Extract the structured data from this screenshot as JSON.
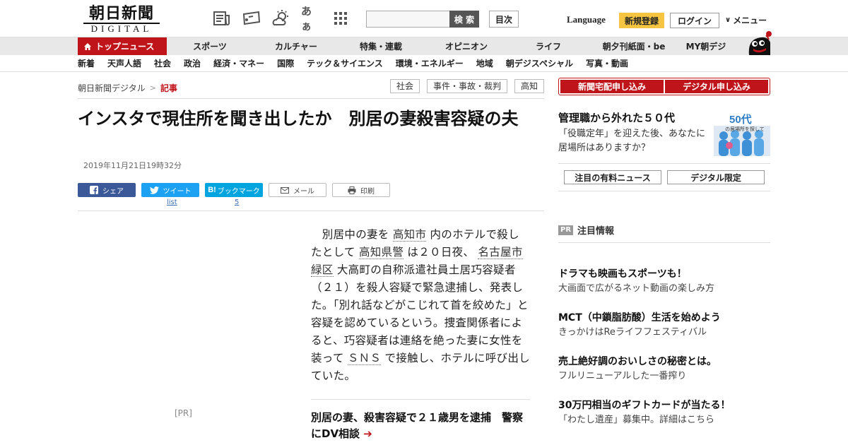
{
  "header": {
    "logo_text": "朝日新聞",
    "logo_sub": "DIGITAL",
    "search_button": "検 索",
    "search_placeholder": "",
    "toc_button": "目次",
    "language": "Language",
    "register": "新規登録",
    "login": "ログイン",
    "menu": "メニュー",
    "font_size_label": "あぁ"
  },
  "nav_primary": [
    {
      "label": "トップニュース",
      "active": true
    },
    {
      "label": "スポーツ"
    },
    {
      "label": "カルチャー"
    },
    {
      "label": "特集・連載"
    },
    {
      "label": "オピニオン"
    },
    {
      "label": "ライフ"
    },
    {
      "label": "朝夕刊紙面・be"
    },
    {
      "label": "MY朝デジ"
    }
  ],
  "nav_secondary": [
    "新着",
    "天声人語",
    "社会",
    "政治",
    "経済・マネー",
    "国際",
    "テック＆サイエンス",
    "環境・エネルギー",
    "地域",
    "朝デジスペシャル",
    "写真・動画"
  ],
  "breadcrumb": {
    "home": "朝日新聞デジタル",
    "separator": ">",
    "current": "記事"
  },
  "tags": [
    "社会",
    "事件・事故・裁判",
    "高知"
  ],
  "article": {
    "headline": "インスタで現住所を聞き出したか　別居の妻殺害容疑の夫",
    "date": "2019年11月21日19時32分",
    "share": {
      "facebook": "シェア",
      "twitter": "ツイート",
      "twitter_count": "list",
      "hatena": "ブックマーク",
      "hatena_count": "5",
      "mail": "メール",
      "print": "印刷"
    },
    "body": {
      "p1": "　別居中の妻を",
      "link1": "高知市",
      "p2": "内のホテルで殺したとして",
      "link2": "高知県警",
      "p3": "は２０日夜、",
      "link3": "名古屋市緑区",
      "p4": "大高町の自称派遣社員土居巧容疑者（２１）を殺人容疑で緊急逮捕し、発表した。「別れ話などがこじれて首を絞めた」と容疑を認めているという。捜査関係者によると、巧容疑者は連絡を絶った妻に女性を装って",
      "link4": "ＳＮＳ",
      "p5": "で接触し、ホテルに呼び出していた。"
    },
    "pr_label": "[PR]",
    "related": "別居の妻、殺害容疑で２１歳男を逮捕　警察にDV相談"
  },
  "sidebar": {
    "subscribe_delivery": "新聞宅配申し込み",
    "subscribe_digital": "デジタル申し込み",
    "ad_title": "管理職から外れた５０代",
    "ad_text": "「役職定年」を迎えた後、あなたに居場所はありますか？",
    "ad_image_text": "50代",
    "ad_image_sub": "の居場所を探して",
    "tab_paid": "注目の有料ニュース",
    "tab_digital": "デジタル限定",
    "pr_badge": "PR",
    "pr_heading": "注目情報",
    "pr_items": [
      {
        "title": "ドラマも映画もスポーツも！",
        "sub": "大画面で広がるネット動画の楽しみ方"
      },
      {
        "title": "MCT（中鎖脂肪酸）生活を始めよう",
        "sub": "きっかけはReライフフェスティバル"
      },
      {
        "title": "売上絶好調のおいしさの秘密とは。",
        "sub": "フルリニューアルした一番搾り"
      },
      {
        "title": "30万円相当のギフトカードが当たる！",
        "sub": "「わたし遺産」募集中。詳細はこちら"
      }
    ]
  },
  "colors": {
    "brand_red": "#c0141b",
    "register_yellow": "#f5c542",
    "facebook": "#3b5998",
    "twitter": "#1da1f2",
    "hatena": "#00a4de"
  }
}
